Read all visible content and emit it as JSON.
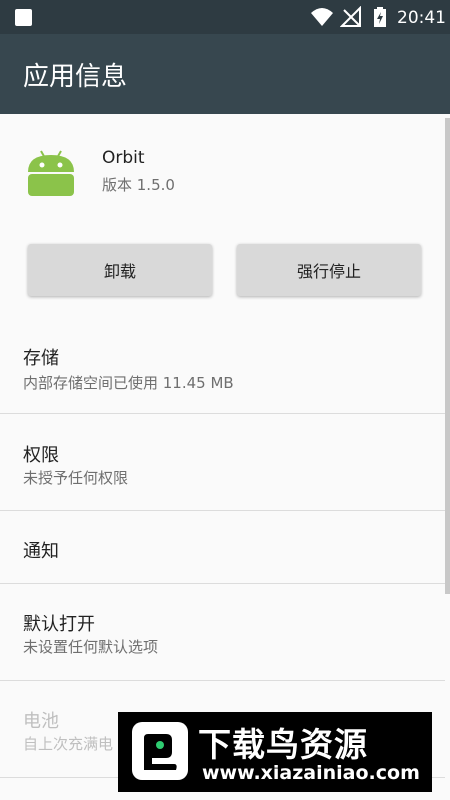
{
  "status_bar": {
    "time": "20:41"
  },
  "toolbar": {
    "title": "应用信息"
  },
  "app": {
    "name": "Orbit",
    "version": "版本 1.5.0"
  },
  "buttons": {
    "uninstall": "卸载",
    "force_stop": "强行停止"
  },
  "rows": [
    {
      "title": "存储",
      "subtitle": "内部存储空间已使用 11.45 MB",
      "enabled": true
    },
    {
      "title": "权限",
      "subtitle": "未授予任何权限",
      "enabled": true
    },
    {
      "title": "通知",
      "subtitle": "",
      "enabled": true
    },
    {
      "title": "默认打开",
      "subtitle": "未设置任何默认选项",
      "enabled": true
    },
    {
      "title": "电池",
      "subtitle": "自上次充满电",
      "enabled": false
    }
  ],
  "watermark": {
    "title": "下载鸟资源",
    "url": "www.xiazainiao.com"
  },
  "colors": {
    "toolbar": "#37474f",
    "status_bar": "#2e3b42",
    "android_green": "#8bc34a"
  }
}
